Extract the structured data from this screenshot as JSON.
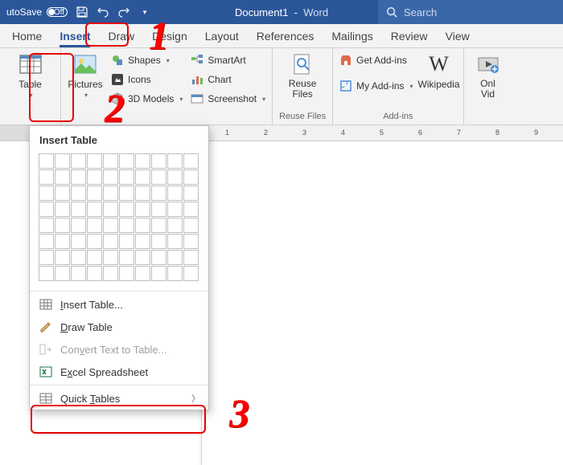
{
  "titlebar": {
    "autosave_label": "utoSave",
    "autosave_state": "Off",
    "doc_name": "Document1",
    "app_name": "Word",
    "search_placeholder": "Search"
  },
  "tabs": [
    "Home",
    "Insert",
    "Draw",
    "Design",
    "Layout",
    "References",
    "Mailings",
    "Review",
    "View"
  ],
  "active_tab": "Insert",
  "ribbon": {
    "tables": {
      "table": "Table"
    },
    "illustrations": {
      "pictures": "Pictures",
      "shapes": "Shapes",
      "icons": "Icons",
      "models3d": "3D Models",
      "smartart": "SmartArt",
      "chart": "Chart",
      "screenshot": "Screenshot"
    },
    "reuse": {
      "label": "Reuse Files",
      "group": "Reuse Files"
    },
    "addins": {
      "get": "Get Add-ins",
      "my": "My Add-ins",
      "wikipedia": "Wikipedia",
      "group": "Add-ins"
    },
    "media": {
      "online_video": "Onl\nVid"
    }
  },
  "menu": {
    "title": "Insert Table",
    "grid_rows": 8,
    "grid_cols": 10,
    "items": [
      {
        "key": "insert_table",
        "label_pre": "",
        "accel": "I",
        "label_post": "nsert Table...",
        "enabled": true,
        "arrow": false
      },
      {
        "key": "draw_table",
        "label_pre": "",
        "accel": "D",
        "label_post": "raw Table",
        "enabled": true,
        "arrow": false
      },
      {
        "key": "convert",
        "label_pre": "Con",
        "accel": "v",
        "label_post": "ert Text to Table...",
        "enabled": false,
        "arrow": false
      },
      {
        "key": "excel",
        "label_pre": "E",
        "accel": "x",
        "label_post": "cel Spreadsheet",
        "enabled": true,
        "arrow": false
      },
      {
        "key": "quick",
        "label_pre": "Quick ",
        "accel": "T",
        "label_post": "ables",
        "enabled": true,
        "arrow": true
      }
    ]
  },
  "markers": {
    "one": "1",
    "two": "2",
    "three": "3"
  },
  "ruler_ticks": [
    1,
    2,
    3,
    4,
    5,
    6,
    7,
    8,
    9
  ]
}
